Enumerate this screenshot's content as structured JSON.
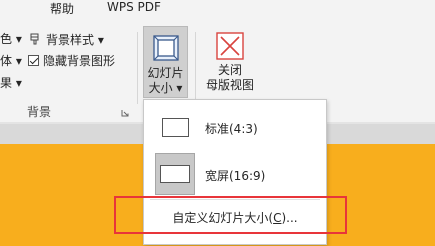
{
  "menu": {
    "help_label": "帮助",
    "wps_pdf_label": "WPS PDF"
  },
  "ribbon": {
    "left_cut_labels": [
      "色 ▾",
      "体 ▾",
      "果 ▾"
    ],
    "format": {
      "bg_style_label": "背景样式 ▾",
      "hide_bg_label": "隐藏背景图形",
      "hide_bg_checked": true
    },
    "group_label": "背景",
    "slide_size": {
      "line1": "幻灯片",
      "line2": "大小 ▾"
    },
    "close_master": {
      "line1": "关闭",
      "line2": "母版视图"
    }
  },
  "dropdown": {
    "standard_label": "标准(4:3)",
    "widescreen_label": "宽屏(16:9)",
    "widescreen_selected": true,
    "custom_prefix": "自定义幻灯片大小(",
    "custom_key": "C",
    "custom_suffix": ")..."
  },
  "colors": {
    "accent_orange": "#f8ae1d",
    "highlight_red": "#e8353a",
    "close_icon_red": "#d9443f"
  }
}
